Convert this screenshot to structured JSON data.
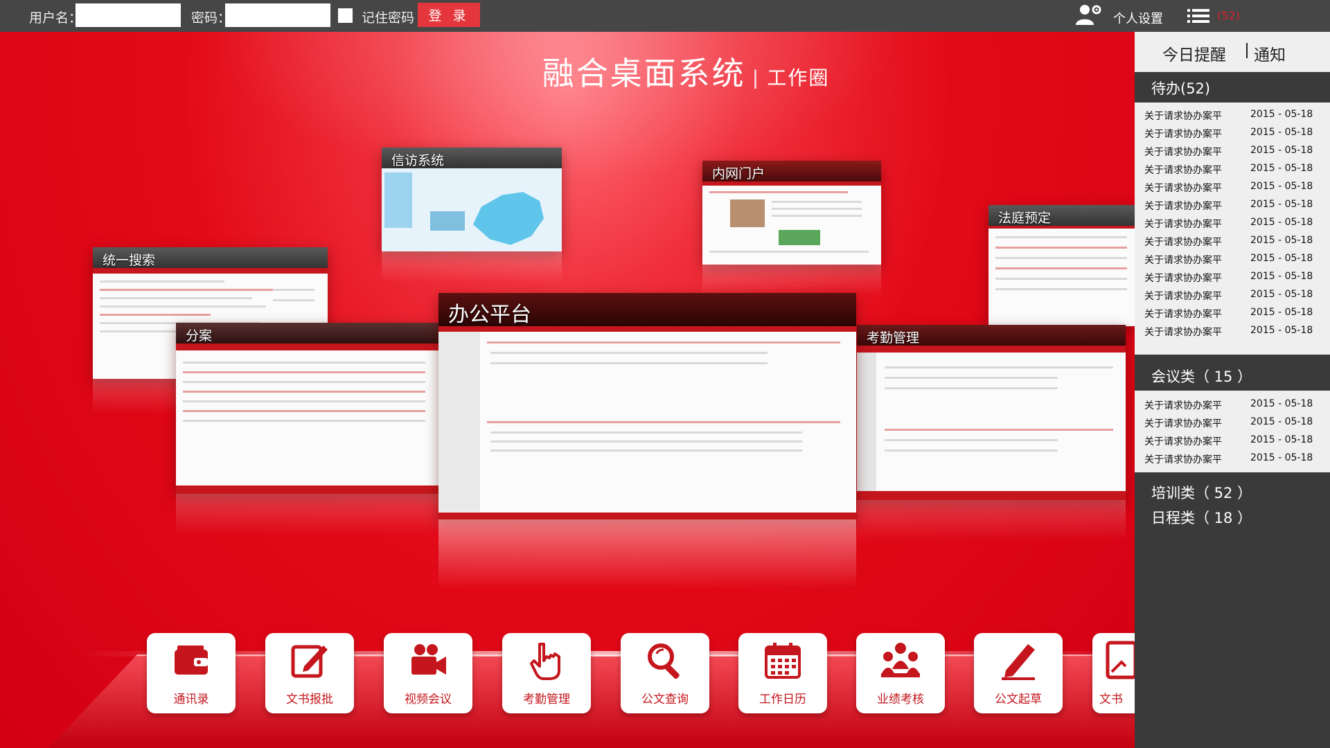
{
  "topbar": {
    "username_label": "用户名：",
    "username_value": "",
    "password_label": "密码：",
    "password_value": "",
    "remember_label": "记住密码",
    "login_button": "登 录",
    "settings_label": "个人设置",
    "list_count": "(52)"
  },
  "header": {
    "title": "融合桌面系统",
    "separator": "|",
    "subtitle": "工作圈"
  },
  "windows": [
    {
      "title": "统一搜索"
    },
    {
      "title": "信访系统"
    },
    {
      "title": "内网门户"
    },
    {
      "title": "法庭预定"
    },
    {
      "title": "分案"
    },
    {
      "title": "办公平台"
    },
    {
      "title": "考勤管理"
    }
  ],
  "dock": [
    {
      "label": "通讯录",
      "icon": "wallet-icon"
    },
    {
      "label": "文书报批",
      "icon": "edit-icon"
    },
    {
      "label": "视频会议",
      "icon": "video-camera-icon"
    },
    {
      "label": "考勤管理",
      "icon": "hand-pointer-icon"
    },
    {
      "label": "公文查询",
      "icon": "magnifier-icon"
    },
    {
      "label": "工作日历",
      "icon": "calendar-icon"
    },
    {
      "label": "业绩考核",
      "icon": "users-group-icon"
    },
    {
      "label": "公文起草",
      "icon": "pencil-icon"
    },
    {
      "label": "文书",
      "icon": "document-icon"
    }
  ],
  "panel": {
    "tab_today": "今日提醒",
    "tab_notice": "通知",
    "todo_header": "待办(52)",
    "todo_items": [
      {
        "title": "关于请求协办案平",
        "date": "2015 - 05-18"
      },
      {
        "title": "关于请求协办案平",
        "date": "2015 - 05-18"
      },
      {
        "title": "关于请求协办案平",
        "date": "2015 - 05-18"
      },
      {
        "title": "关于请求协办案平",
        "date": "2015 - 05-18"
      },
      {
        "title": "关于请求协办案平",
        "date": "2015 - 05-18"
      },
      {
        "title": "关于请求协办案平",
        "date": "2015 - 05-18"
      },
      {
        "title": "关于请求协办案平",
        "date": "2015 - 05-18"
      },
      {
        "title": "关于请求协办案平",
        "date": "2015 - 05-18"
      },
      {
        "title": "关于请求协办案平",
        "date": "2015 - 05-18"
      },
      {
        "title": "关于请求协办案平",
        "date": "2015 - 05-18"
      },
      {
        "title": "关于请求协办案平",
        "date": "2015 - 05-18"
      },
      {
        "title": "关于请求协办案平",
        "date": "2015 - 05-18"
      },
      {
        "title": "关于请求协办案平",
        "date": "2015 - 05-18"
      }
    ],
    "meeting_header": "会议类（ 15 ）",
    "meeting_items": [
      {
        "title": "关于请求协办案平",
        "date": "2015 - 05-18"
      },
      {
        "title": "关于请求协办案平",
        "date": "2015 - 05-18"
      },
      {
        "title": "关于请求协办案平",
        "date": "2015 - 05-18"
      },
      {
        "title": "关于请求协办案平",
        "date": "2015 - 05-18"
      }
    ],
    "training_header": "培训类（ 52 ）",
    "schedule_header": "日程类（ 18 ）"
  },
  "colors": {
    "brand_red": "#e30613",
    "topbar": "#464646",
    "panel_dark": "#3a3a3a",
    "panel_light": "#efefef"
  }
}
